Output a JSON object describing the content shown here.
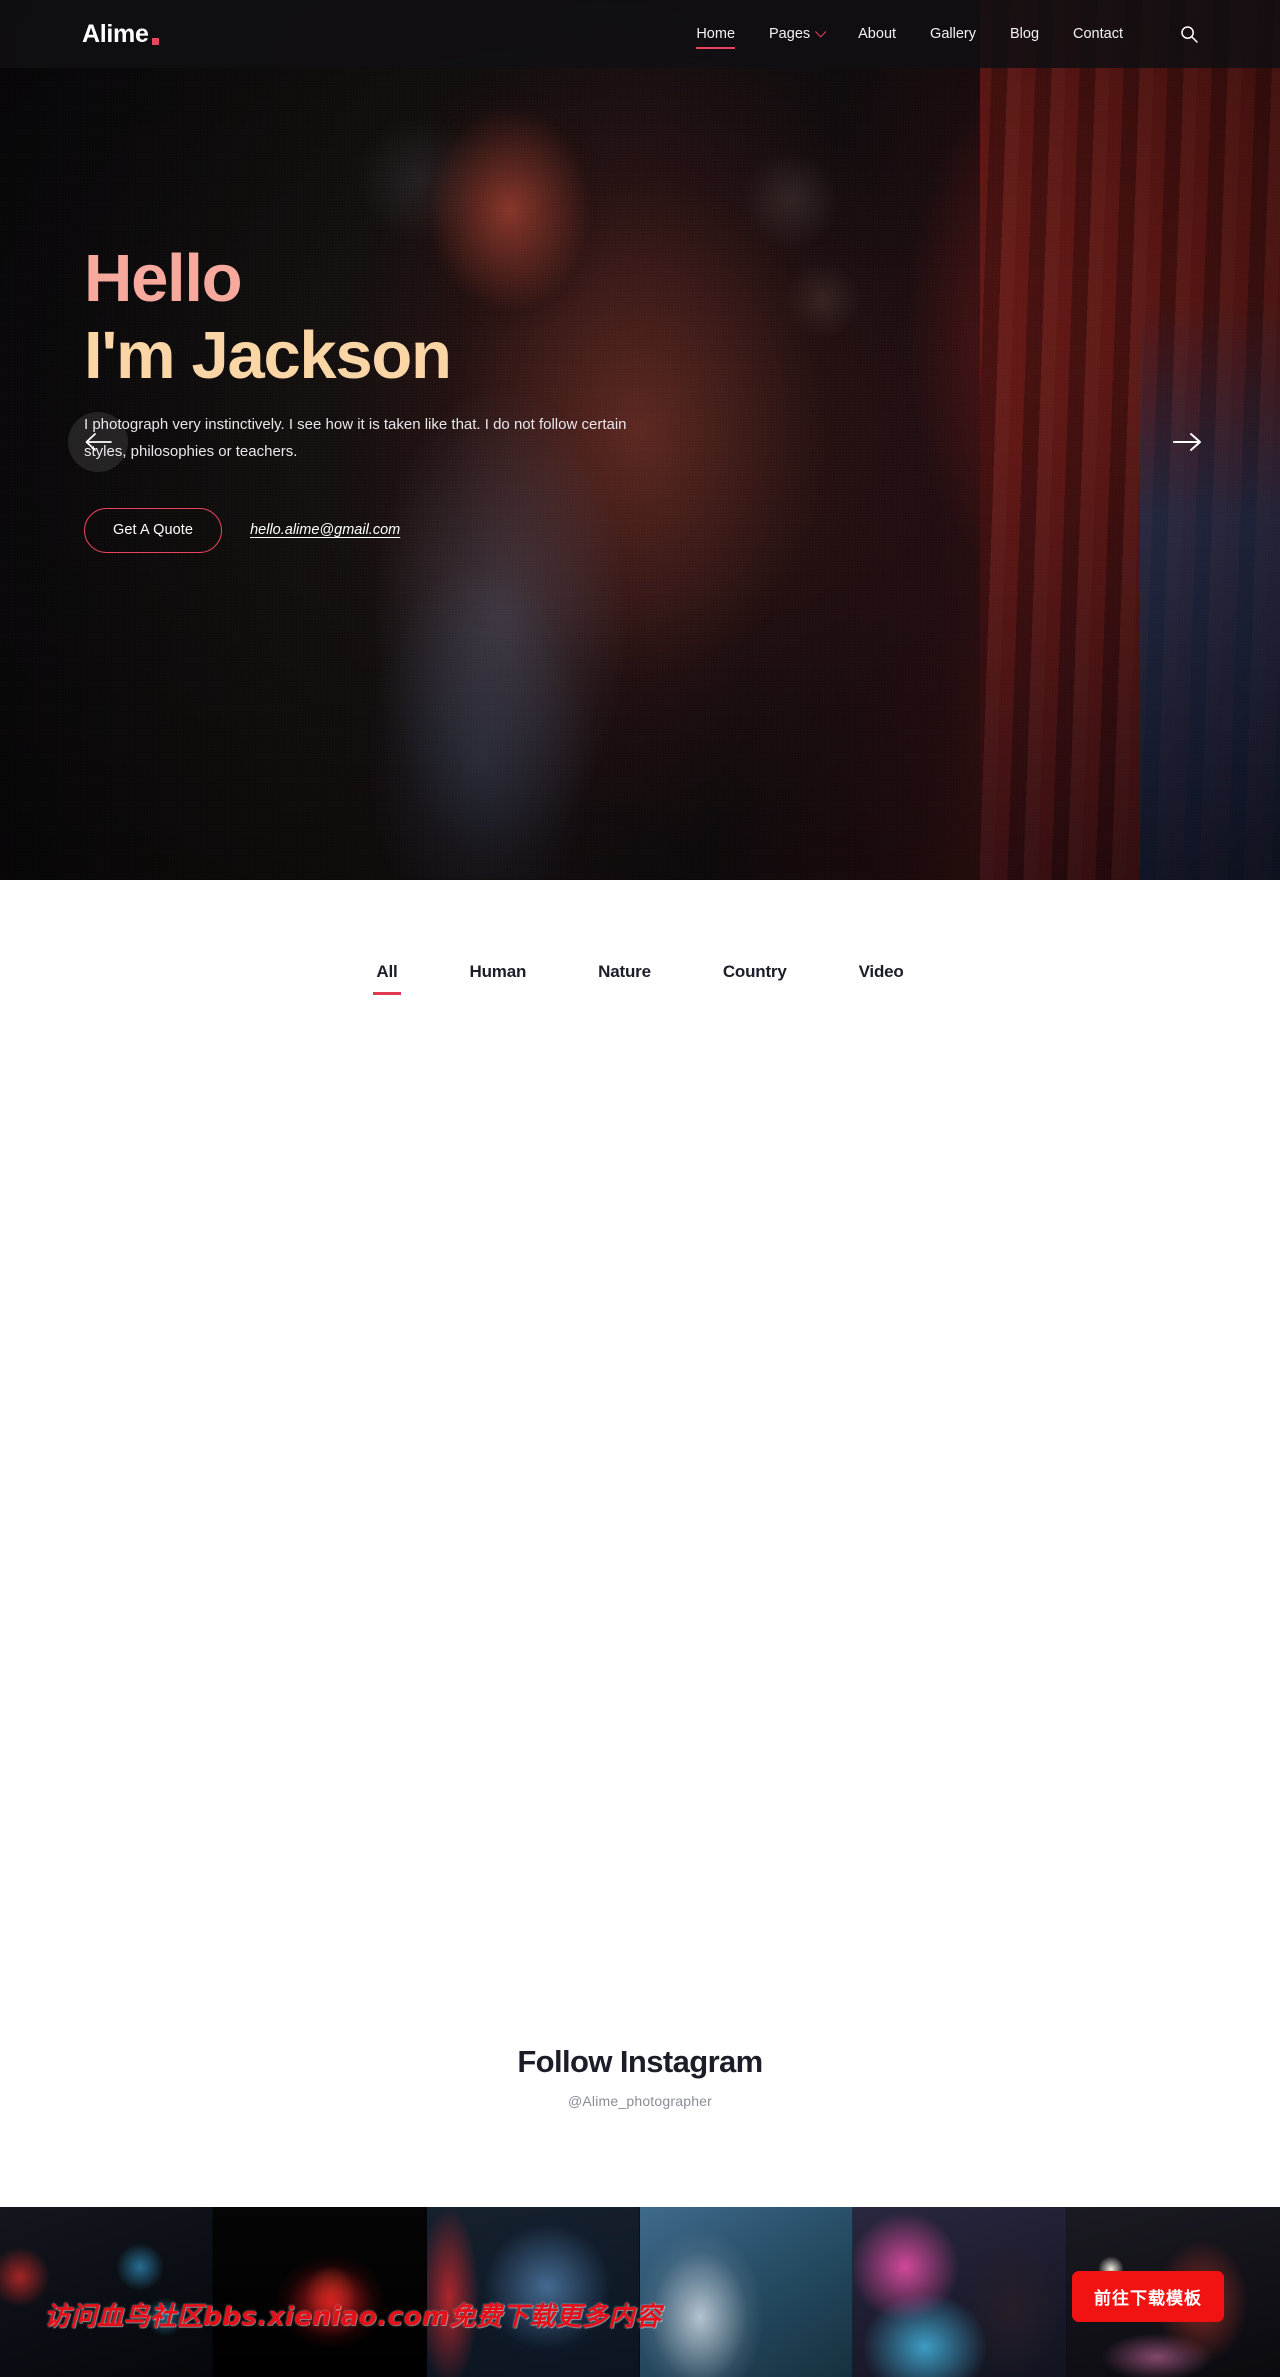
{
  "header": {
    "logo_text": "Alime",
    "logo_dot": "",
    "nav": [
      {
        "label": "Home",
        "active": true,
        "has_caret": false
      },
      {
        "label": "Pages",
        "active": false,
        "has_caret": true
      },
      {
        "label": "About",
        "active": false,
        "has_caret": false
      },
      {
        "label": "Gallery",
        "active": false,
        "has_caret": false
      },
      {
        "label": "Blog",
        "active": false,
        "has_caret": false
      },
      {
        "label": "Contact",
        "active": false,
        "has_caret": false
      }
    ],
    "search_icon": "search-icon"
  },
  "hero": {
    "greeting": "Hello",
    "name_line": "I'm Jackson",
    "description": "I photograph very instinctively. I see how it is taken like that. I do not follow certain styles, philosophies or teachers.",
    "cta_label": "Get A Quote",
    "email": "hello.alime@gmail.com",
    "prev_icon": "arrow-left-icon",
    "next_icon": "arrow-right-icon",
    "colors": {
      "greeting": "#f7a99e",
      "name": "#fad5a5",
      "accent": "#e8445f"
    }
  },
  "gallery": {
    "filters": [
      {
        "label": "All",
        "active": true
      },
      {
        "label": "Human",
        "active": false
      },
      {
        "label": "Nature",
        "active": false
      },
      {
        "label": "Country",
        "active": false
      },
      {
        "label": "Video",
        "active": false
      }
    ],
    "active_underline_color": "#e0394f"
  },
  "instagram": {
    "title": "Follow Instagram",
    "handle": "@Alime_photographer",
    "tiles": [
      {
        "name": "insta-tile-1"
      },
      {
        "name": "insta-tile-2"
      },
      {
        "name": "insta-tile-3"
      },
      {
        "name": "insta-tile-4"
      },
      {
        "name": "insta-tile-5"
      },
      {
        "name": "insta-tile-6"
      }
    ]
  },
  "overlay": {
    "watermark": "访问血鸟社区bbs.xieniao.com免费下载更多内容",
    "download_button": "前往下载模板",
    "download_button_color": "#f31212",
    "watermark_color": "#e6101a"
  }
}
